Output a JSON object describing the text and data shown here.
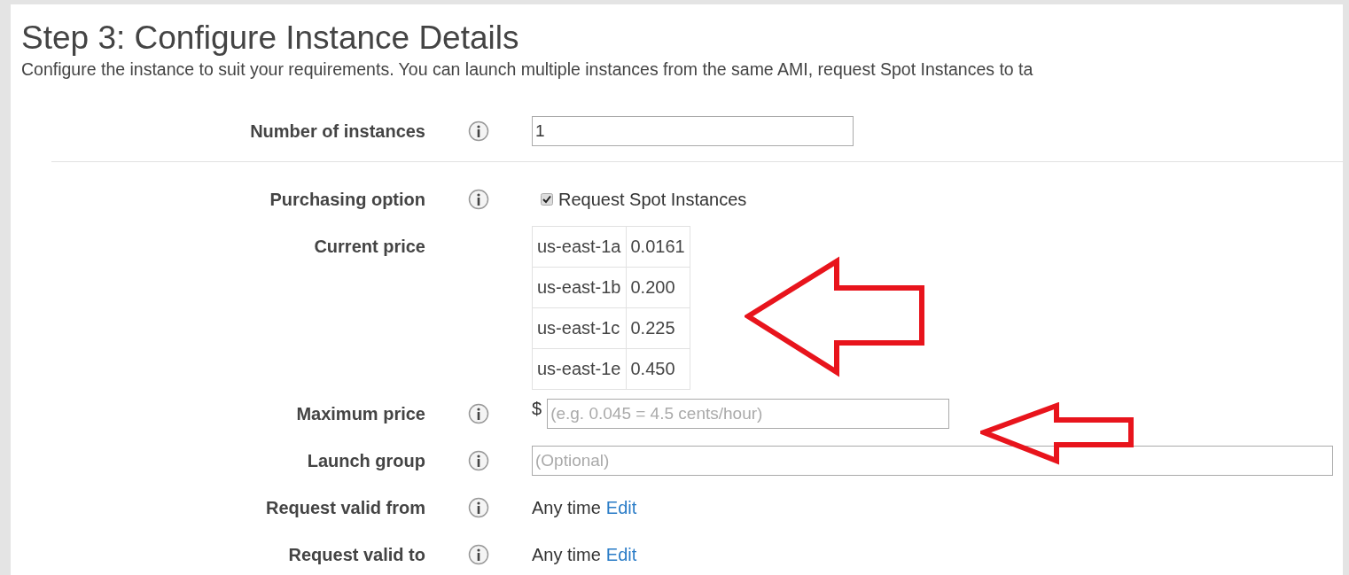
{
  "page": {
    "title": "Step 3: Configure Instance Details",
    "description": "Configure the instance to suit your requirements. You can launch multiple instances from the same AMI, request Spot Instances to ta"
  },
  "sections": [
    {
      "fields": [
        {
          "kind": "input",
          "label": "Number of instances",
          "info": true,
          "value": "1"
        }
      ]
    },
    {
      "fields": [
        {
          "kind": "checkbox",
          "label": "Purchasing option",
          "info": true,
          "checked": true,
          "text": "Request Spot Instances"
        },
        {
          "kind": "table",
          "label": "Current price",
          "info": false,
          "rows": [
            {
              "zone": "us-east-1a",
              "price": "0.0161"
            },
            {
              "zone": "us-east-1b",
              "price": "0.200"
            },
            {
              "zone": "us-east-1c",
              "price": "0.225"
            },
            {
              "zone": "us-east-1e",
              "price": "0.450"
            }
          ]
        },
        {
          "kind": "price",
          "label": "Maximum price",
          "info": true,
          "prefix": "$",
          "placeholder": "(e.g. 0.045 = 4.5 cents/hour)"
        },
        {
          "kind": "wide_input",
          "label": "Launch group",
          "info": true,
          "placeholder": "(Optional)"
        },
        {
          "kind": "edit",
          "label": "Request valid from",
          "info": true,
          "text": "Any time",
          "link": "Edit"
        },
        {
          "kind": "edit",
          "label": "Request valid to",
          "info": true,
          "text": "Any time",
          "link": "Edit"
        }
      ]
    }
  ]
}
